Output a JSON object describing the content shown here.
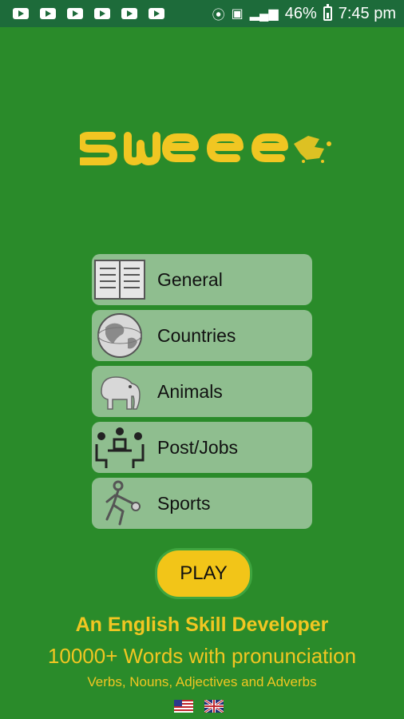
{
  "status_bar": {
    "battery_percent": "46%",
    "time": "7:45 pm",
    "notification_icons": [
      "youtube-icon",
      "youtube-icon",
      "youtube-icon",
      "youtube-icon",
      "youtube-icon",
      "youtube-icon"
    ]
  },
  "app": {
    "logo_text": "SWEE"
  },
  "menu": {
    "items": [
      {
        "label": "General",
        "icon": "book-icon"
      },
      {
        "label": "Countries",
        "icon": "globe-icon"
      },
      {
        "label": "Animals",
        "icon": "elephant-icon"
      },
      {
        "label": "Post/Jobs",
        "icon": "meeting-people-icon"
      },
      {
        "label": "Sports",
        "icon": "athlete-icon"
      }
    ]
  },
  "play_button": {
    "label": "PLAY"
  },
  "taglines": {
    "line1": "An English Skill Developer",
    "line2": "10000+ Words with pronunciation",
    "line3": "Verbs, Nouns, Adjectives and Adverbs"
  },
  "flags": [
    "us-flag-icon",
    "uk-flag-icon"
  ],
  "colors": {
    "background": "#2a8b2a",
    "accent_yellow": "#f1c622",
    "menu_item_bg": "#8fbe8f",
    "play_button": "#f2c518",
    "status_bar": "#1d6b3a"
  }
}
